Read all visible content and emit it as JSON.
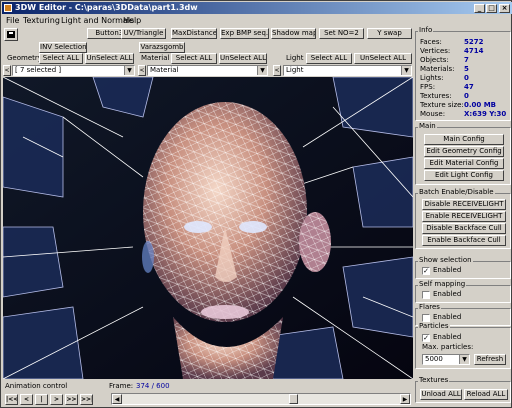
{
  "window": {
    "title": "3DW Editor - C:\\paras\\3DData\\part1.3dw",
    "minimize": "_",
    "maximize": "□",
    "close": "×"
  },
  "menu": [
    "File",
    "Texturing",
    "Light and Normals",
    "Help"
  ],
  "toolbar": {
    "row1": [
      "Button34",
      "UV/Triangle",
      "MaxDistance",
      "Exp BMP seq.",
      "Shadow map",
      "Set NO=2",
      "Y swap"
    ],
    "inv_selection": "INV Selection",
    "varazsgomb": "Varazsgomb"
  },
  "geometry": {
    "label": "Geometry",
    "select_all": "Select ALL",
    "unselect_all": "UnSelect ALL",
    "combo": "[ 7 selected ]",
    "lt_left": "<",
    "lt_right": ">"
  },
  "material": {
    "label": "Material",
    "select_all": "Select ALL",
    "unselect_all": "UnSelect ALL",
    "combo": "Material",
    "lt_left": "<",
    "lt_right": ">"
  },
  "light": {
    "label": "Light",
    "select_all": "Select ALL",
    "unselect_all": "UnSelect ALL",
    "combo": "Light",
    "lt_left": "<",
    "lt_right": ">"
  },
  "info": {
    "title": "Info",
    "rows": [
      {
        "label": "Faces:",
        "value": "5272"
      },
      {
        "label": "Vertices:",
        "value": "4714"
      },
      {
        "label": "Objects:",
        "value": "7"
      },
      {
        "label": "Materials:",
        "value": "5"
      },
      {
        "label": "Lights:",
        "value": "0"
      },
      {
        "label": "FPS:",
        "value": "47"
      },
      {
        "label": "Textures:",
        "value": "0"
      },
      {
        "label": "Texture size:",
        "value": "0.00 MB"
      },
      {
        "label": "Mouse:",
        "value": "X:639 Y:30"
      }
    ]
  },
  "main_group": {
    "title": "Main",
    "buttons": [
      "Main Config",
      "Edit Geometry Config",
      "Edit Material Config",
      "Edit Light Config"
    ]
  },
  "batch_group": {
    "title": "Batch Enable/Disable",
    "buttons": [
      "Disable RECEIVELIGHT",
      "Enable RECEIVELIGHT",
      "Disable Backface Cull",
      "Enable Backface Cull"
    ]
  },
  "show_selection": {
    "title": "Show selection",
    "checkbox": "Enabled",
    "checked": true
  },
  "self_mapping": {
    "title": "Self mapping",
    "checkbox": "Enabled",
    "checked": false
  },
  "flares": {
    "title": "Flares",
    "checkbox": "Enabled",
    "checked": false
  },
  "particles": {
    "title": "Particles",
    "checkbox": "Enabled",
    "checked": true,
    "max_label": "Max. particles:",
    "max_value": "5000",
    "refresh": "Refresh"
  },
  "textures": {
    "title": "Textures",
    "unload": "Unload ALL",
    "reload": "Reload ALL"
  },
  "animation": {
    "label": "Animation control",
    "frame_label": "Frame:",
    "frame_value": "374 / 600",
    "nav": [
      "|<<",
      "<",
      "|",
      ">",
      ">>",
      ">>|"
    ],
    "slider_fraction": 0.62
  },
  "colors": {
    "title_start": "#0a246a",
    "title_end": "#a6caf0",
    "info_value": "#0000a0",
    "frame_value": "#0000a0"
  }
}
